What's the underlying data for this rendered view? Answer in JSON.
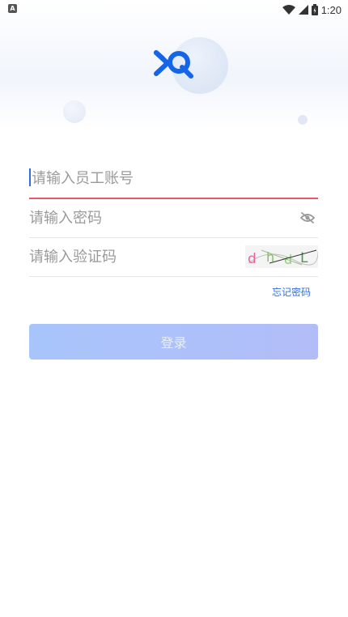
{
  "status_bar": {
    "time": "1:20",
    "left_icon_text": "A"
  },
  "form": {
    "account_placeholder": "请输入员工账号",
    "password_placeholder": "请输入密码",
    "captcha_placeholder": "请输入验证码",
    "captcha_text": [
      "d",
      "h",
      "d",
      "L"
    ],
    "forgot_label": "忘记密码",
    "login_label": "登录"
  },
  "colors": {
    "accent": "#2f6fe0",
    "error_underline": "#e8576a",
    "button_gradient_start": "#a8c5fb",
    "button_gradient_end": "#b2bdf8"
  }
}
